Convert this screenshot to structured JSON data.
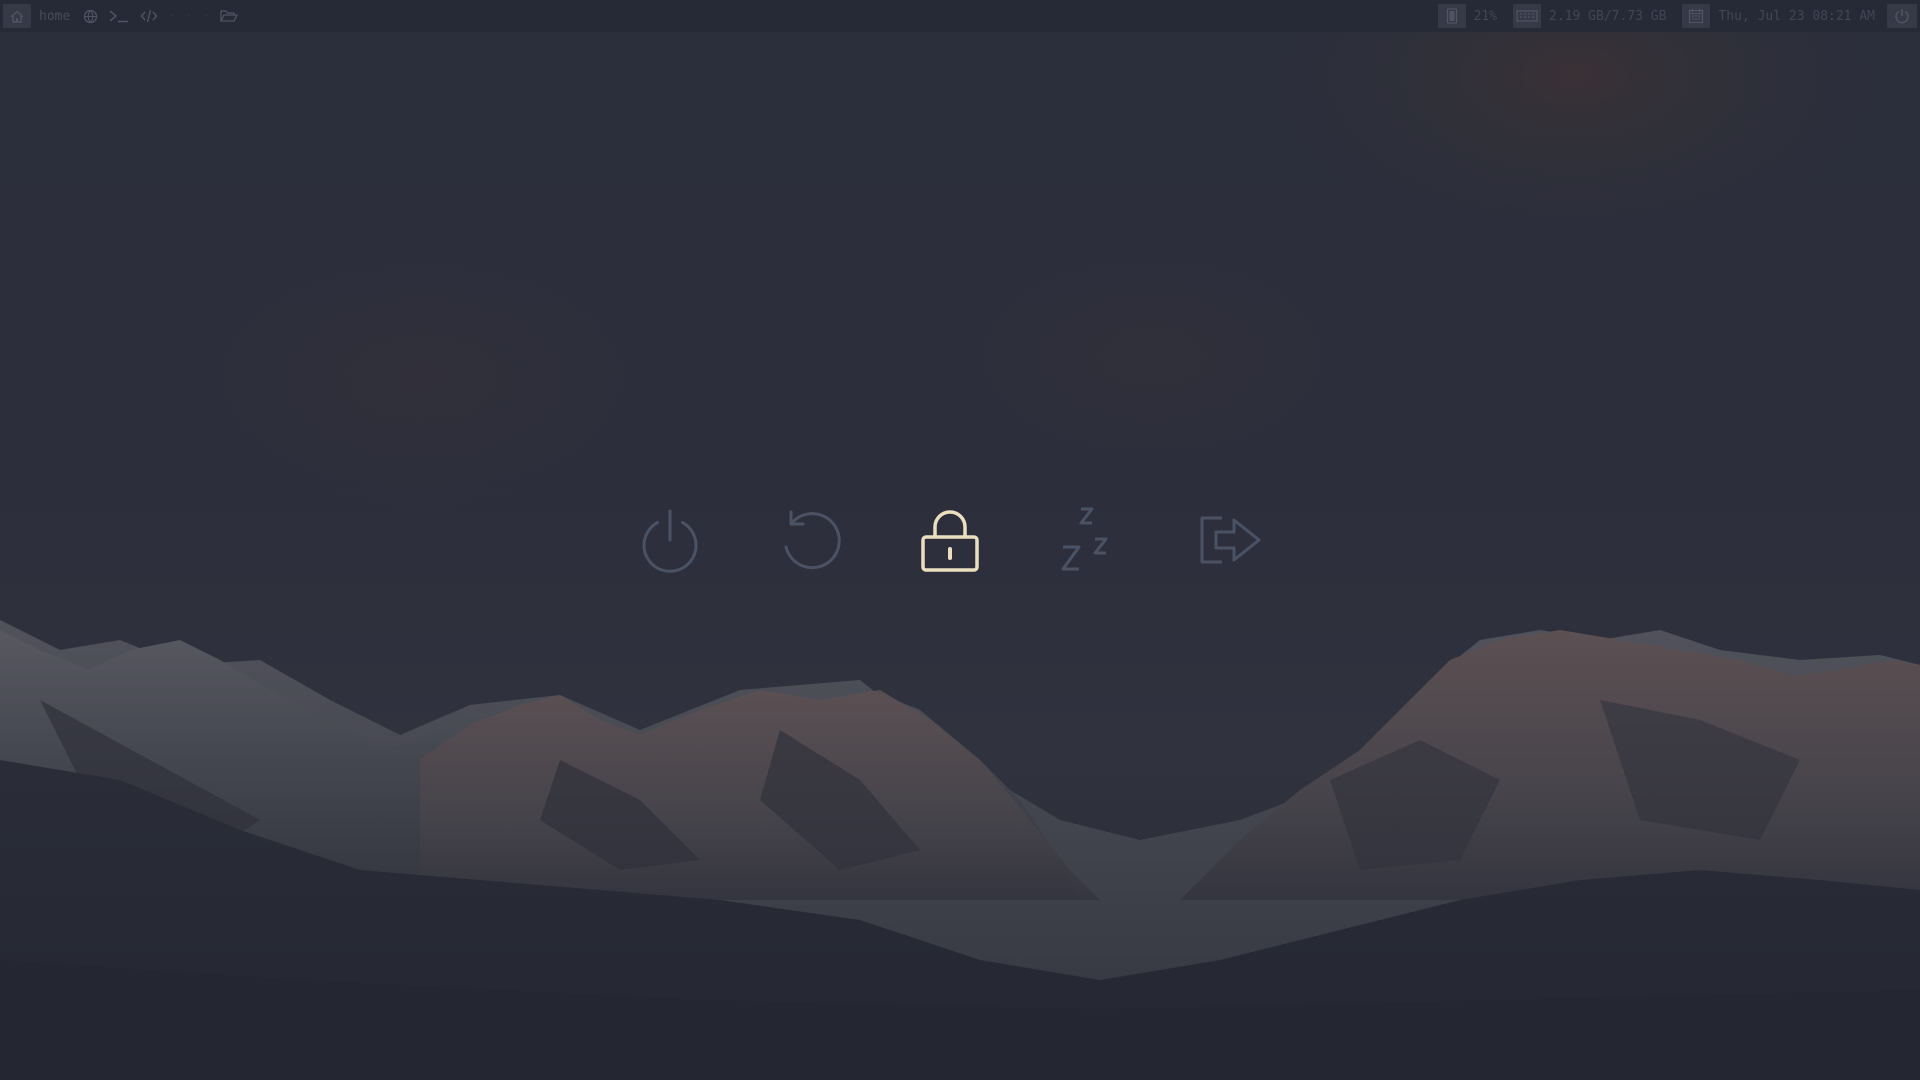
{
  "colors": {
    "bar_bg": "#262a36",
    "icon_dim": "#4b5264",
    "icon_active": "#ebdfc0"
  },
  "topbar": {
    "workspace_label": "home",
    "workspace_icons": [
      "home-icon",
      "globe-icon",
      "terminal-icon",
      "code-icon",
      "workspace-4",
      "workspace-5",
      "workspace-6",
      "folder-open-icon"
    ],
    "workspace_dim_labels": [
      "·",
      "·",
      "·"
    ],
    "status": {
      "brightness_icon": "brightness-icon",
      "brightness": "21%",
      "memory_icon": "memory-icon",
      "memory": "2.19 GB/7.73 GB",
      "calendar_icon": "calendar-icon",
      "datetime": "Thu, Jul 23 08:21 AM",
      "power_icon": "power-icon"
    }
  },
  "power_menu": {
    "items": [
      {
        "name": "shutdown",
        "icon": "power-icon",
        "active": false
      },
      {
        "name": "reboot",
        "icon": "restart-icon",
        "active": false
      },
      {
        "name": "lock",
        "icon": "lock-icon",
        "active": true
      },
      {
        "name": "suspend",
        "icon": "sleep-zzz-icon",
        "active": false
      },
      {
        "name": "logout",
        "icon": "logout-arrow-icon",
        "active": false
      }
    ]
  }
}
